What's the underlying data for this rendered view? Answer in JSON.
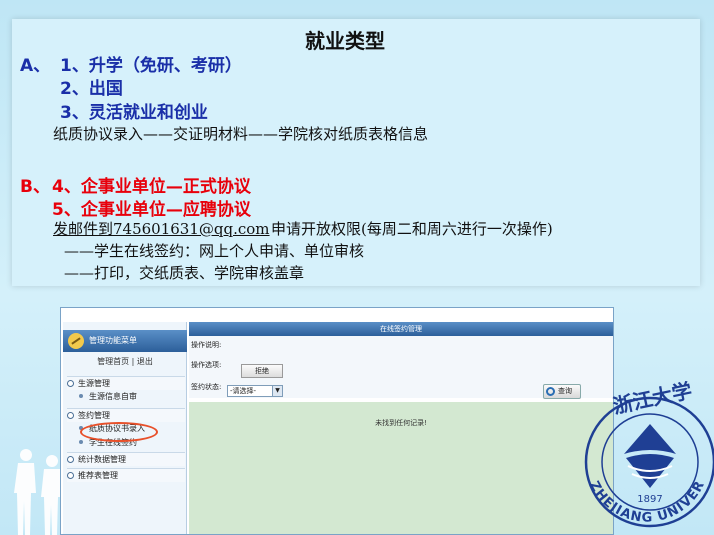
{
  "slide": {
    "title": "就业类型",
    "a_prefix": "A、",
    "items_a": [
      "1、升学（免研、考研）",
      "2、出国",
      "3、灵活就业和创业"
    ],
    "a_note": "纸质协议录入——交证明材料——学院核对纸质表格信息",
    "b_prefix": "B、",
    "items_b": [
      "4、企事业单位—正式协议",
      "5、企事业单位—应聘协议"
    ],
    "email_link": "发邮件到745601631@qq.com",
    "email_rest": "申请开放权限(每周二和周六进行一次操作)",
    "step1": "——学生在线签约：网上个人申请、单位审核",
    "step2": "——打印，交纸质表、学院审核盖章"
  },
  "screenshot": {
    "side_header": "管理功能菜单",
    "side_links": "管理首页 | 退出",
    "menu": [
      {
        "type": "group",
        "label": "生源管理"
      },
      {
        "type": "sub",
        "label": "生源信息自审"
      },
      {
        "type": "group",
        "label": "签约管理"
      },
      {
        "type": "sub",
        "label": "纸质协议书录入"
      },
      {
        "type": "sub",
        "label": "学生在线签约"
      },
      {
        "type": "group",
        "label": "统计数据管理"
      },
      {
        "type": "group",
        "label": "推荐表管理"
      }
    ],
    "main_title": "在线签约管理",
    "op_desc_label": "操作说明:",
    "op_opts_label": "操作选项:",
    "reject_button": "拒绝",
    "status_label": "签约状态:",
    "status_select": "-请选择-",
    "query_button": "查询",
    "empty_message": "未找到任何记录!"
  },
  "logo": {
    "year": "1897",
    "text_arc": "ZHEJIANG UNIVERSITY",
    "calligraphy": "浙江大学"
  },
  "colors": {
    "blue_text": "#1a2fa8",
    "red_text": "#e8000b",
    "logo_blue": "#1f3f94"
  }
}
